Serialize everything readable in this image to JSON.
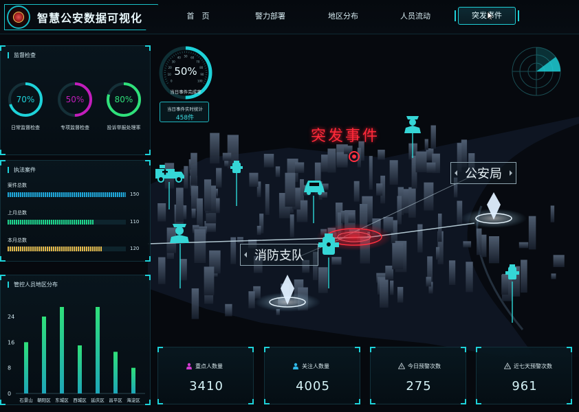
{
  "header": {
    "title": "智慧公安数据可视化",
    "nav": [
      "首　页",
      "警力部署",
      "地区分布",
      "人员流动",
      "突发事件"
    ],
    "active_nav": "突发事件"
  },
  "supervision": {
    "title": "监督检查",
    "items": [
      {
        "label": "日常监督检查",
        "value_text": "70%",
        "value": 0.7,
        "color": "#1ed2d9"
      },
      {
        "label": "专项监督检查",
        "value_text": "50%",
        "value": 0.5,
        "color": "#c21dbb"
      },
      {
        "label": "投诉举报处理率",
        "value_text": "80%",
        "value": 0.8,
        "color": "#2fe07a"
      }
    ]
  },
  "cases": {
    "title": "执法案件",
    "items": [
      {
        "label": "案件总数",
        "value": 150,
        "max": 150,
        "color": "#1ea6d9"
      },
      {
        "label": "上月总数",
        "value": 110,
        "max": 150,
        "color": "#1fd48a"
      },
      {
        "label": "本月总数",
        "value": 120,
        "max": 150,
        "color": "#e6b84a"
      }
    ]
  },
  "district_chart": {
    "title": "管控人员地区分布"
  },
  "chart_data": {
    "type": "bar",
    "title": "管控人员地区分布",
    "categories": [
      "石景山",
      "朝阳区",
      "东城区",
      "西城区",
      "延庆区",
      "昌平区",
      "海淀区"
    ],
    "values": [
      16,
      24,
      27,
      15,
      27,
      13,
      8
    ],
    "yticks": [
      0,
      8,
      16,
      24,
      30
    ],
    "ylim": [
      0,
      30
    ],
    "grid": false
  },
  "gauge": {
    "percent_text": "50%",
    "percent": 0.5,
    "label": "当日事件完成率",
    "tick_labels": [
      "0",
      "10",
      "20",
      "30",
      "40",
      "50",
      "60",
      "70",
      "80",
      "90",
      "100"
    ]
  },
  "realtime_count": {
    "label": "当日事件实时统计",
    "value": "458件"
  },
  "map": {
    "event_label": "突发事件",
    "police_tag": "公安局",
    "fire_tag": "消防支队"
  },
  "stats": [
    {
      "label": "重点人数量",
      "value": "3410",
      "icon": "person-icon",
      "icon_color": "#d23bd0"
    },
    {
      "label": "关注人数量",
      "value": "4005",
      "icon": "person-icon",
      "icon_color": "#2fb7e6"
    },
    {
      "label": "今日预警次数",
      "value": "275",
      "icon": "warning-icon",
      "icon_color": "#b6c2c8"
    },
    {
      "label": "近七天预警次数",
      "value": "961",
      "icon": "warning-icon",
      "icon_color": "#b6c2c8"
    }
  ],
  "colors": {
    "accent": "#1ed2d9",
    "alert": "#ff2a3a",
    "background": "#05080d"
  }
}
